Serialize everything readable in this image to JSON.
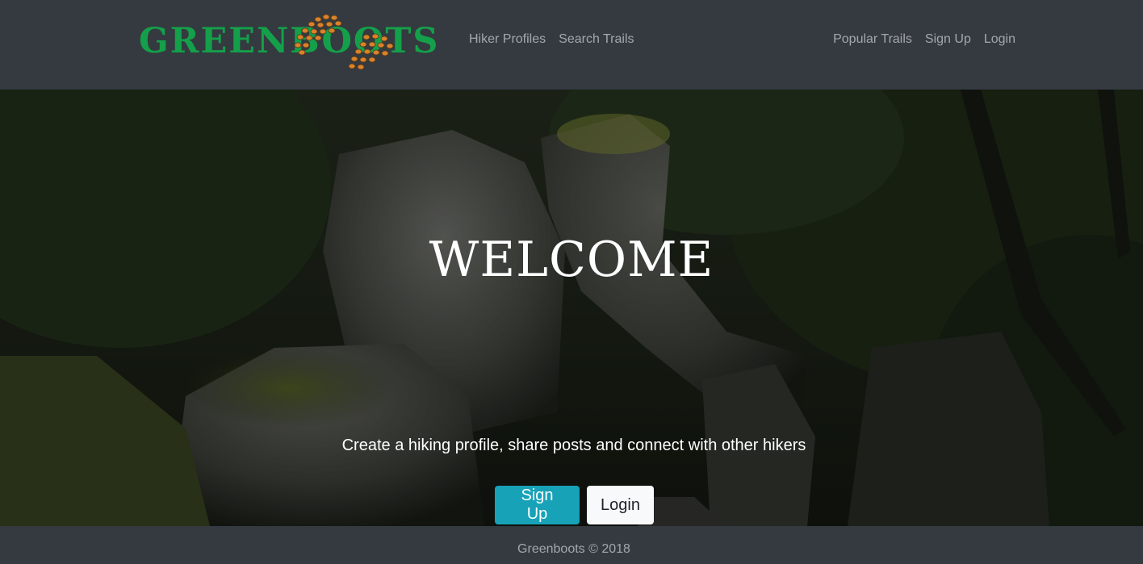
{
  "brand": {
    "name": "GREENBOOTS",
    "color": "#14a04a",
    "boot_color": "#d9822b"
  },
  "nav": {
    "left": [
      {
        "label": "Hiker Profiles"
      },
      {
        "label": "Search Trails"
      }
    ],
    "right": [
      {
        "label": "Popular Trails"
      },
      {
        "label": "Sign Up"
      },
      {
        "label": "Login"
      }
    ]
  },
  "hero": {
    "title": "WELCOME",
    "tagline": "Create a hiking profile, share posts and connect with other hikers",
    "signup_label": "Sign Up",
    "login_label": "Login",
    "background": "forest-boulders-photo"
  },
  "footer": {
    "text": "Greenboots © 2018"
  },
  "colors": {
    "navbar": "#343a40",
    "accent": "#17a2b8",
    "light": "#f8f9fa"
  }
}
